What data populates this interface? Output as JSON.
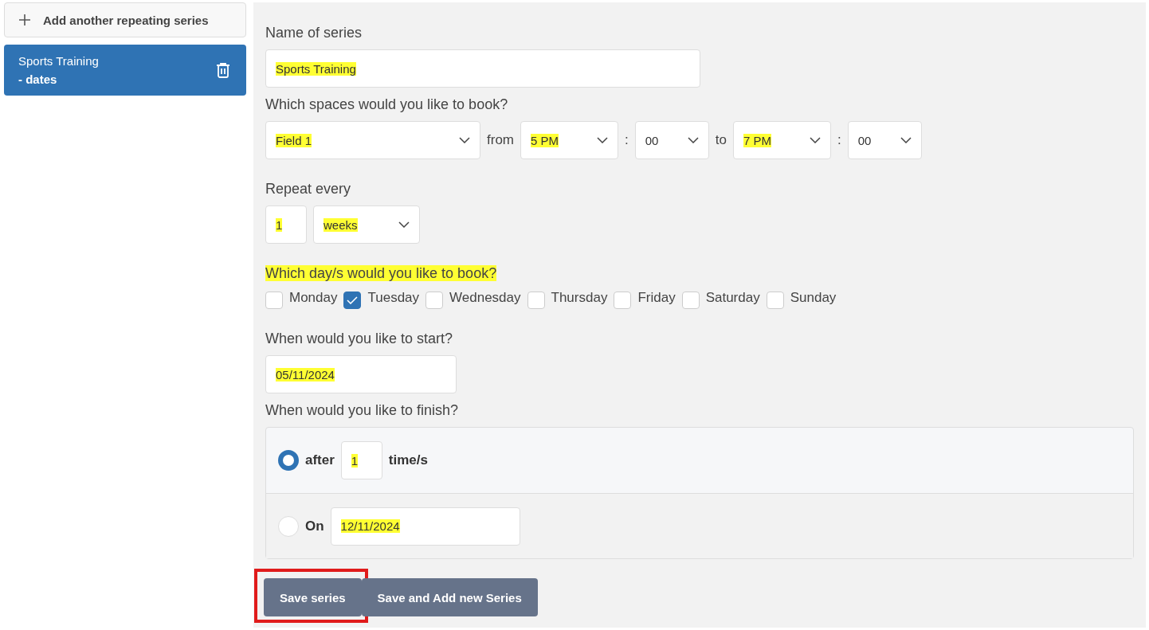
{
  "sidebar": {
    "add_button": "Add another repeating series",
    "series": [
      {
        "title": "Sports Training",
        "subtitle": "- dates",
        "selected": true
      }
    ]
  },
  "form": {
    "name": {
      "label": "Name of series",
      "value": "Sports Training",
      "highlighted": true
    },
    "spaces": {
      "label": "Which spaces would you like to book?",
      "parts": [
        {
          "kind": "space-select",
          "value": "Field 1",
          "highlighted": true
        },
        {
          "kind": "text",
          "value": "from"
        },
        {
          "kind": "hour-select",
          "value": "5 PM",
          "highlighted": true
        },
        {
          "kind": "text",
          "value": ":"
        },
        {
          "kind": "minute-select",
          "value": "00",
          "highlighted": false
        },
        {
          "kind": "text",
          "value": "to"
        },
        {
          "kind": "hour-select",
          "value": "7 PM",
          "highlighted": true
        },
        {
          "kind": "text",
          "value": ":"
        },
        {
          "kind": "minute-select",
          "value": "00",
          "highlighted": false
        }
      ]
    },
    "repeat": {
      "label": "Repeat every",
      "count": {
        "value": "1",
        "highlighted": true
      },
      "unit": {
        "value": "weeks",
        "highlighted": true
      }
    },
    "days": {
      "label": "Which day/s would you like to book?",
      "highlighted": true,
      "items": [
        {
          "label": "Monday",
          "checked": false
        },
        {
          "label": "Tuesday",
          "checked": true
        },
        {
          "label": "Wednesday",
          "checked": false
        },
        {
          "label": "Thursday",
          "checked": false
        },
        {
          "label": "Friday",
          "checked": false
        },
        {
          "label": "Saturday",
          "checked": false
        },
        {
          "label": "Sunday",
          "checked": false
        }
      ]
    },
    "start": {
      "label": "When would you like to start?",
      "value": "05/11/2024",
      "highlighted": true
    },
    "finish": {
      "label": "When would you like to finish?",
      "options": [
        {
          "kind": "count",
          "label": "after",
          "selected": true,
          "value": "1",
          "highlighted": true,
          "suffix": "time/s"
        },
        {
          "kind": "date",
          "label": "On",
          "selected": false,
          "value": "12/11/2024",
          "highlighted": true
        }
      ]
    },
    "buttons": [
      {
        "label": "Save series",
        "annotated": true
      },
      {
        "label": "Save and Add new Series",
        "annotated": false
      }
    ]
  }
}
